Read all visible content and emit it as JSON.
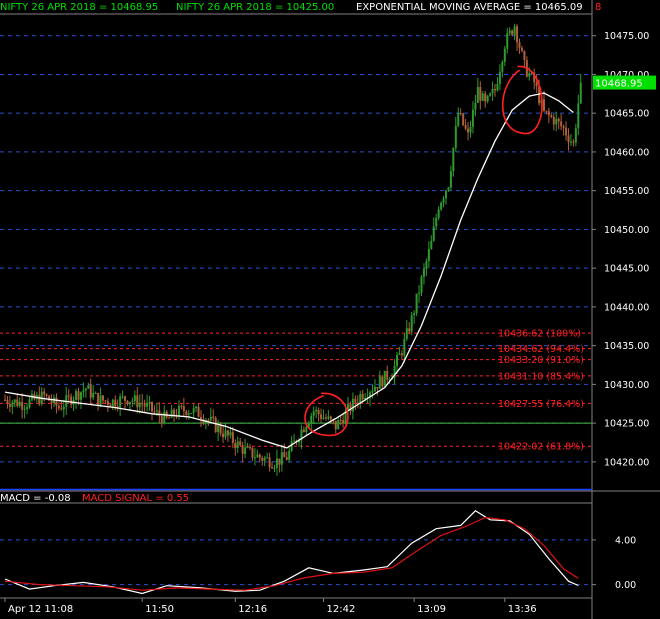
{
  "header": {
    "nifty_price_label": "NIFTY 26 APR 2018 = 10468.95",
    "nifty_second_label": "NIFTY 26 APR 2018 = 10425.00",
    "ema_label": "EXPONENTIAL MOVING AVERAGE = 10465.09",
    "top_right_marker": "8"
  },
  "macd_header": {
    "macd_label": "MACD = -0.08",
    "signal_label": "MACD SIGNAL = 0.55"
  },
  "colors": {
    "background": "#000000",
    "up_candle": "#2e9b2e",
    "down_candle": "#b06038",
    "ema": "#ffffff",
    "fib": "#ff2020",
    "grid": "#2a4fd0",
    "level_line": "#40c040",
    "price_badge": "#00e000",
    "macd_line": "#ffffff",
    "signal_line": "#e01010",
    "header_green": "#00e000",
    "header_white": "#ffffff",
    "annotation": "#ff2020"
  },
  "chart_data": [
    {
      "type": "candlestick",
      "title": "",
      "ylim": [
        10416.5,
        10477.8
      ],
      "y_ticks": [
        10420,
        10425,
        10430,
        10435,
        10440,
        10445,
        10450,
        10455,
        10460,
        10465,
        10470,
        10475
      ],
      "y_tick_labels": [
        "10420.00",
        "10425.00",
        "10430.00",
        "10435.00",
        "10440.00",
        "10445.00",
        "10450.00",
        "10455.00",
        "10460.00",
        "10465.00",
        "10470.00",
        "10475.00"
      ],
      "last_price_badge": "10468.95",
      "horizontal_level": 10425.0,
      "fibonacci_levels": [
        {
          "value": 10436.62,
          "label": "10436.62 (100%)"
        },
        {
          "value": 10434.62,
          "label": "10434.62 (94.4%)"
        },
        {
          "value": 10433.2,
          "label": "10433.20 (91.0%)"
        },
        {
          "value": 10431.1,
          "label": "10431.10 (85.4%)"
        },
        {
          "value": 10427.55,
          "label": "10427.55 (76.4%)"
        },
        {
          "value": 10422.02,
          "label": "10422.02 (61.8%)"
        }
      ],
      "price_path": [
        [
          0,
          10428.0
        ],
        [
          8,
          10427.5
        ],
        [
          16,
          10428.5
        ],
        [
          22,
          10427.0
        ],
        [
          28,
          10428.5
        ],
        [
          33,
          10429.5
        ],
        [
          38,
          10428.0
        ],
        [
          44,
          10427.8
        ],
        [
          50,
          10428.2
        ],
        [
          56,
          10427.5
        ],
        [
          62,
          10426.2
        ],
        [
          66,
          10425.4
        ],
        [
          70,
          10426.4
        ],
        [
          74,
          10426.8
        ],
        [
          80,
          10426.2
        ],
        [
          86,
          10424.6
        ],
        [
          92,
          10423.0
        ],
        [
          98,
          10421.4
        ],
        [
          104,
          10420.6
        ],
        [
          110,
          10420.0
        ],
        [
          115,
          10420.6
        ],
        [
          120,
          10423.6
        ],
        [
          126,
          10426.6
        ],
        [
          131,
          10425.6
        ],
        [
          135,
          10424.6
        ],
        [
          140,
          10426.6
        ],
        [
          145,
          10428.6
        ],
        [
          150,
          10429.6
        ],
        [
          154,
          10430.6
        ],
        [
          158,
          10431.6
        ],
        [
          162,
          10434.4
        ],
        [
          166,
          10438.4
        ],
        [
          170,
          10443.4
        ],
        [
          174,
          10448.2
        ],
        [
          177,
          10453.2
        ],
        [
          181,
          10456.0
        ],
        [
          185,
          10465.0
        ],
        [
          189,
          10462.0
        ],
        [
          193,
          10468.0
        ],
        [
          196,
          10466.0
        ],
        [
          200,
          10468.0
        ],
        [
          204,
          10474.0
        ],
        [
          208,
          10476.4
        ],
        [
          212,
          10471.0
        ],
        [
          216,
          10469.0
        ],
        [
          220,
          10465.0
        ],
        [
          224,
          10464.2
        ],
        [
          228,
          10463.0
        ],
        [
          232,
          10461.0
        ],
        [
          235,
          10468.95
        ]
      ],
      "ema": [
        [
          0,
          10429.0
        ],
        [
          15,
          10428.2
        ],
        [
          30,
          10427.6
        ],
        [
          45,
          10427.0
        ],
        [
          60,
          10426.2
        ],
        [
          75,
          10425.8
        ],
        [
          90,
          10424.6
        ],
        [
          105,
          10422.8
        ],
        [
          115,
          10421.8
        ],
        [
          125,
          10423.8
        ],
        [
          135,
          10425.6
        ],
        [
          145,
          10427.6
        ],
        [
          155,
          10429.6
        ],
        [
          162,
          10432.4
        ],
        [
          170,
          10437.6
        ],
        [
          178,
          10444.0
        ],
        [
          186,
          10451.2
        ],
        [
          193,
          10456.6
        ],
        [
          200,
          10461.4
        ],
        [
          207,
          10465.4
        ],
        [
          214,
          10467.2
        ],
        [
          220,
          10467.6
        ],
        [
          226,
          10466.6
        ],
        [
          232,
          10465.09
        ]
      ],
      "x_tick_labels": [
        {
          "label": "Apr 12 11:08",
          "bar": 0
        },
        {
          "label": "11:50",
          "bar": 56
        },
        {
          "label": "12:16",
          "bar": 94
        },
        {
          "label": "12:42",
          "bar": 130
        },
        {
          "label": "13:09",
          "bar": 167
        },
        {
          "label": "13:36",
          "bar": 204
        }
      ]
    },
    {
      "type": "line",
      "title": "",
      "ylim": [
        -1.2,
        7.3
      ],
      "y_ticks": [
        0,
        4
      ],
      "y_tick_labels": [
        "0.00",
        "4.00"
      ],
      "series": [
        {
          "name": "MACD",
          "points": [
            [
              0,
              0.5
            ],
            [
              10,
              -0.4
            ],
            [
              20,
              -0.1
            ],
            [
              32,
              0.2
            ],
            [
              44,
              -0.2
            ],
            [
              56,
              -0.8
            ],
            [
              66,
              -0.1
            ],
            [
              80,
              -0.3
            ],
            [
              94,
              -0.6
            ],
            [
              104,
              -0.5
            ],
            [
              114,
              0.3
            ],
            [
              124,
              1.5
            ],
            [
              134,
              1.0
            ],
            [
              146,
              1.3
            ],
            [
              156,
              1.6
            ],
            [
              166,
              3.7
            ],
            [
              176,
              5.0
            ],
            [
              186,
              5.3
            ],
            [
              192,
              6.6
            ],
            [
              198,
              5.8
            ],
            [
              206,
              5.7
            ],
            [
              214,
              4.5
            ],
            [
              222,
              2.3
            ],
            [
              230,
              0.3
            ],
            [
              234,
              -0.08
            ]
          ]
        },
        {
          "name": "MACD SIGNAL",
          "points": [
            [
              0,
              0.3
            ],
            [
              14,
              0.0
            ],
            [
              28,
              -0.1
            ],
            [
              42,
              -0.2
            ],
            [
              56,
              -0.5
            ],
            [
              70,
              -0.3
            ],
            [
              84,
              -0.4
            ],
            [
              98,
              -0.5
            ],
            [
              110,
              -0.1
            ],
            [
              122,
              0.6
            ],
            [
              134,
              1.0
            ],
            [
              146,
              1.1
            ],
            [
              158,
              1.5
            ],
            [
              168,
              3.0
            ],
            [
              178,
              4.4
            ],
            [
              188,
              5.2
            ],
            [
              196,
              6.0
            ],
            [
              204,
              5.8
            ],
            [
              212,
              5.0
            ],
            [
              220,
              3.5
            ],
            [
              228,
              1.4
            ],
            [
              234,
              0.55
            ]
          ]
        }
      ]
    }
  ],
  "annotations": [
    {
      "name": "circle-annotation-left",
      "center_bar": 131,
      "center_value": 10426.0
    },
    {
      "name": "circle-annotation-right",
      "center_bar": 211,
      "center_value": 10466.5
    }
  ]
}
